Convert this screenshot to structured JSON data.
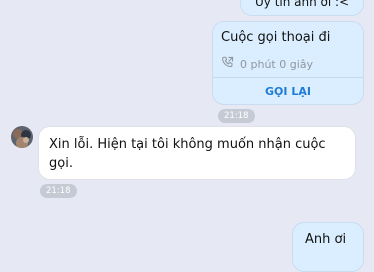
{
  "messages": {
    "top_outgoing": {
      "text": "Uy tín anh ơi :<"
    },
    "call_card": {
      "title": "Cuộc gọi thoại đi",
      "duration": "0 phút 0 giây",
      "action_label": "GỌI LẠI",
      "time": "21:18"
    },
    "incoming_reply": {
      "text": "Xin lỗi. Hiện tại tôi không muốn nhận cuộc gọi.",
      "time": "21:18"
    },
    "bottom_outgoing": {
      "text": "Anh ơi"
    }
  },
  "icons": {
    "call_status": "outgoing-call-icon",
    "avatar": "contact-avatar"
  },
  "colors": {
    "background": "#e6e9f3",
    "outgoing_bubble": "#dbeeff",
    "incoming_bubble": "#ffffff",
    "accent": "#1e7bd6",
    "time_pill": "#c5cad4"
  }
}
